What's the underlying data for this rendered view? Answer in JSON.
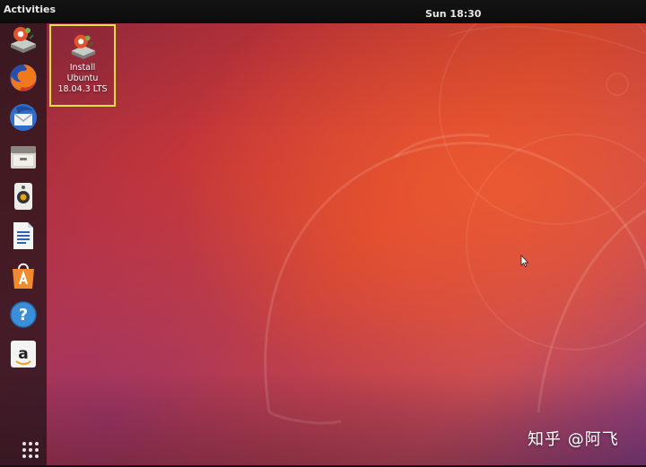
{
  "top_bar": {
    "activities_label": "Activities",
    "clock": "Sun 18:30"
  },
  "dock": {
    "items": [
      {
        "name": "install-ubuntu",
        "icon": "installer-icon"
      },
      {
        "name": "firefox",
        "icon": "firefox-icon"
      },
      {
        "name": "thunderbird",
        "icon": "thunderbird-icon"
      },
      {
        "name": "files",
        "icon": "files-icon"
      },
      {
        "name": "rhythmbox",
        "icon": "rhythmbox-icon"
      },
      {
        "name": "libreoffice-writer",
        "icon": "writer-icon"
      },
      {
        "name": "ubuntu-software",
        "icon": "software-center-icon"
      },
      {
        "name": "help",
        "icon": "help-icon"
      },
      {
        "name": "amazon",
        "icon": "amazon-icon"
      }
    ],
    "apps_grid_icon": "show-applications-icon"
  },
  "desktop_icons": [
    {
      "icon": "installer-icon",
      "label_lines": [
        "Install",
        "Ubuntu",
        "18.04.3 LTS"
      ],
      "selected": true
    }
  ],
  "watermark": "知乎 @阿飞",
  "colors": {
    "top_bar": "#0c0c0c",
    "selection_border": "#e6e33a",
    "wallpaper_orange": "#d8442f",
    "wallpaper_purple": "#8a3f86"
  }
}
